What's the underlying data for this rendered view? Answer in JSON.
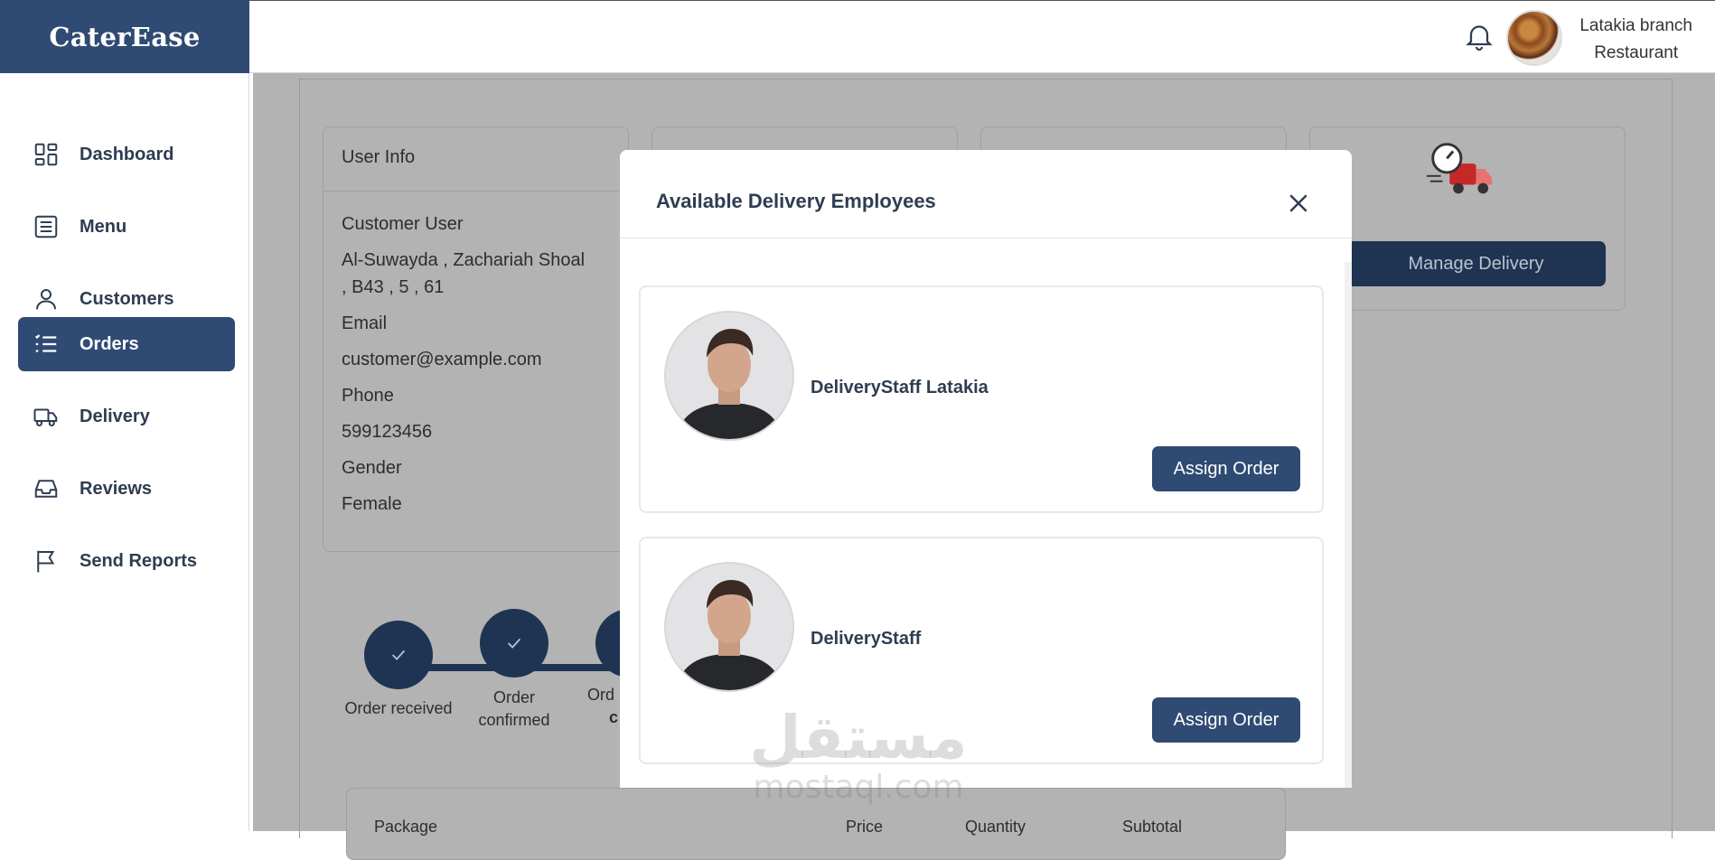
{
  "brand": "CaterEase",
  "sidebar": {
    "items": [
      {
        "label": "Dashboard",
        "icon": "dashboard-icon"
      },
      {
        "label": "Menu",
        "icon": "menu-list-icon"
      },
      {
        "label": "Customers",
        "icon": "user-icon"
      },
      {
        "label": "Orders",
        "icon": "orders-list-icon",
        "active": true
      },
      {
        "label": "Delivery",
        "icon": "truck-icon"
      },
      {
        "label": "Reviews",
        "icon": "inbox-icon"
      },
      {
        "label": "Send Reports",
        "icon": "flag-icon"
      }
    ]
  },
  "header": {
    "branch": "Latakia branch",
    "role": "Restaurant"
  },
  "background": {
    "user_info": {
      "title": "User Info",
      "name": "Customer User",
      "address_1": "Al-Suwayda , Zachariah Shoal",
      "address_2": ", B43 , 5 , 61",
      "email_label": "Email",
      "email": "customer@example.com",
      "phone_label": "Phone",
      "phone": "599123456",
      "gender_label": "Gender",
      "gender": "Female"
    },
    "manage_delivery": "Manage Delivery",
    "steps": [
      {
        "label": "Order received"
      },
      {
        "label_1": "Order",
        "label_2": "confirmed"
      },
      {
        "label_1": "Ord",
        "label_2": "c"
      }
    ],
    "table_headers": [
      "Package",
      "Price",
      "Quantity",
      "Subtotal"
    ]
  },
  "modal": {
    "title": "Available Delivery Employees",
    "employees": [
      {
        "name": "DeliveryStaff Latakia",
        "button": "Assign Order"
      },
      {
        "name": "DeliveryStaff",
        "button": "Assign Order"
      }
    ]
  },
  "watermark": {
    "arabic": "مستقل",
    "latin": "mostaql.com"
  },
  "colors": {
    "primary": "#2f4b73",
    "overlay": "#b3b3b3",
    "text": "#2f3d52"
  }
}
